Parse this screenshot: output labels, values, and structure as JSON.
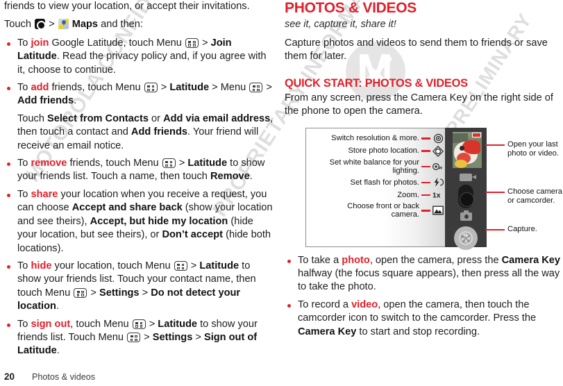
{
  "footer": {
    "page_number": "20",
    "section": "Photos & videos"
  },
  "watermark": {
    "line1": "MOTOROLA CONFIDENTIAL",
    "line2": "PROPRIETARY INFORMATION",
    "line3": "DRAFT & PRELIMINARY",
    "logo_letter": "M"
  },
  "left_column": {
    "intro_tail": "friends to view your location, or accept their invitations.",
    "touch_line": {
      "prefix": "Touch",
      "sep": ">",
      "app": "Maps",
      "suffix": "and then:"
    },
    "bullets": [
      {
        "id": "join",
        "keyword": "join",
        "text_html": "To <span class=\"red\">join</span> Google Latitude, touch Menu [MENU] &gt; <b>Join Latitude</b>. Read the privacy policy and, if you agree with it, choose to continue."
      },
      {
        "id": "add",
        "keyword": "add",
        "text_html": "To <span class=\"red\">add</span> friends, touch Menu [MENU] &gt; <b>Latitude</b> &gt; Menu [MENU] &gt; <b>Add friends</b>.",
        "sub_html": "Touch <b>Select from Contacts</b> or <b>Add via email address</b>, then touch a contact and <b>Add friends</b>. Your friend will receive an email notice."
      },
      {
        "id": "remove",
        "keyword": "remove",
        "text_html": "To <span class=\"red\">remove</span> friends, touch Menu [MENU] &gt; <b>Latitude</b> to show your friends list. Touch a name, then touch <b>Remove</b>."
      },
      {
        "id": "share",
        "keyword": "share",
        "text_html": "To <span class=\"red\">share</span> your location when you receive a request, you can choose <b>Accept and share back</b> (show your location and see theirs), <b>Accept, but hide my location</b> (hide your location, but see theirs), or <b>Don’t accept</b> (hide both locations)."
      },
      {
        "id": "hide",
        "keyword": "hide",
        "text_html": "To <span class=\"red\">hide</span> your location, touch Menu [MENU] &gt; <b>Latitude</b> to show your friends list. Touch your contact name, then touch Menu [MENU] &gt; <b>Settings</b> &gt; <b>Do not detect your location</b>."
      },
      {
        "id": "signout",
        "keyword": "sign out",
        "text_html": "To <span class=\"red\">sign out</span>, touch Menu [MENU] &gt; <b>Latitude</b> to show your friends list. Touch Menu [MENU] &gt; <b>Settings</b> &gt; <b>Sign out of Latitude</b>."
      }
    ]
  },
  "right_column": {
    "heading": "PHOTOS & VIDEOS",
    "subheading": "see it, capture it, share it!",
    "intro": "Capture photos and videos to send them to friends or save them for later.",
    "quick_start_heading": "QUICK START: PHOTOS & VIDEOS",
    "quick_start_text": "From any screen, press the Camera Key on the right side of the phone to open the camera.",
    "figure": {
      "left_labels": [
        {
          "label": "Switch resolution & more.",
          "icon": "settings-circle-icon"
        },
        {
          "label": "Store photo location.",
          "icon": "geotag-diamond-icon"
        },
        {
          "label": "Set white balance for your lighting.",
          "icon": "white-balance-icon"
        },
        {
          "label": "Set flash for photos.",
          "icon": "flash-icon"
        },
        {
          "label": "Zoom.",
          "icon": "zoom-1x-icon"
        },
        {
          "label": "Choose front or back camera.",
          "icon": "front-back-camera-icon"
        }
      ],
      "right_callouts": [
        {
          "label": "Open your last photo or video.",
          "target": "last-photo-thumbnail"
        },
        {
          "label": "Choose camera or camcorder.",
          "target": "camera-camcorder-toggle"
        },
        {
          "label": "Capture.",
          "target": "shutter-button"
        }
      ]
    },
    "bullets": [
      {
        "id": "take-photo",
        "keyword": "photo",
        "text_html": "To take a <span class=\"red\">photo</span>, open the camera, press the <b>Camera Key</b> halfway (the focus square appears), then press all the way to take the photo."
      },
      {
        "id": "record-video",
        "keyword": "video",
        "text_html": "To record a <span class=\"red\">video</span>, open the camera, then touch the camcorder icon to switch to the camcorder. Press the <b>Camera Key</b> to start and stop recording."
      }
    ]
  },
  "colors": {
    "accent_red": "#E0202A",
    "text": "#1c1c1c",
    "phone_body": "#3b3b3b"
  }
}
